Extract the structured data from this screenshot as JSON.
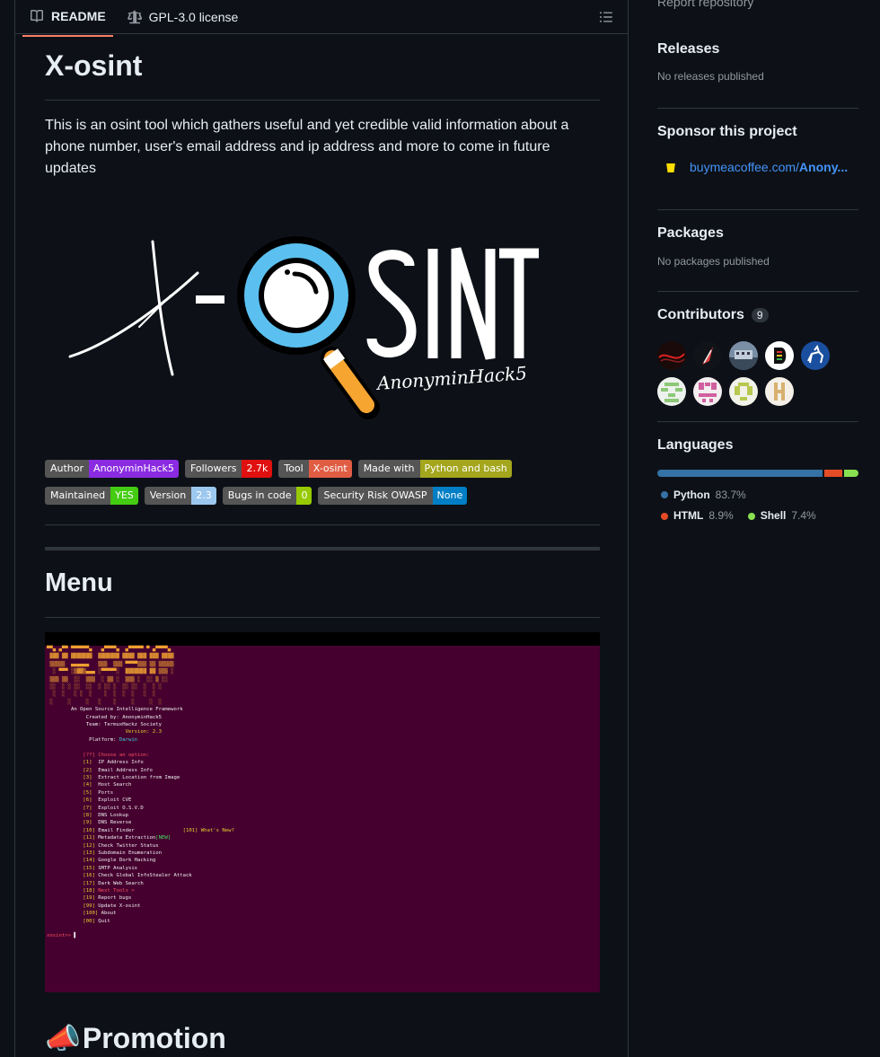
{
  "tabs": {
    "readme": "README",
    "license": "GPL-3.0 license"
  },
  "readme": {
    "title": "X-osint",
    "description": "This is an osint tool which gathers useful and yet credible valid information about a phone number, user's email address and ip address and more to come in future updates",
    "logo": {
      "word_left": "X-",
      "word_right": "SINT",
      "signature": "AnonyminHack5"
    },
    "badges_row1": [
      {
        "key": "Author",
        "value": "AnonyminHack5",
        "color": "#8a2be2"
      },
      {
        "key": "Followers",
        "value": "2.7k",
        "color": "#e01010"
      },
      {
        "key": "Tool",
        "value": "X-osint",
        "color": "#e05d44"
      },
      {
        "key": "Made with",
        "value": "Python and bash",
        "color": "#a4a61d"
      }
    ],
    "badges_row2": [
      {
        "key": "Maintained",
        "value": "YES",
        "color": "#4c1"
      },
      {
        "key": "Version",
        "value": "2.3",
        "color": "#9cc8ef"
      },
      {
        "key": "Bugs in code",
        "value": "0",
        "color": "#97ca00"
      },
      {
        "key": "Security Risk OWASP",
        "value": "None",
        "color": "#007ec6"
      }
    ],
    "menu_heading": "Menu",
    "terminal": {
      "tagline": "An Open Source Intelligence Framework",
      "created_by": "Created by: AnonyminHack5",
      "team": "Team: TermuxHackz Society",
      "version": "Version: 2.3",
      "platform_label": "Platform:",
      "platform_value": "Darwin",
      "prompt_choose": "[??] Choose an option:",
      "options": [
        "[1]  IP Address Info",
        "[2]  Email Address Info",
        "[3]  Extract Location from Image",
        "[4]  Host Search",
        "[5]  Ports",
        "[6]  Exploit CVE",
        "[7]  Exploit O.S.V.D",
        "[8]  DNS Lookup",
        "[9]  DNS Reverse",
        "[10] Email Finder",
        "[11] Metadata Extraction",
        "[12] Check Twitter Status",
        "[13] Subdomain Enumeration",
        "[14] Google Dork Hacking",
        "[15] SMTP Analysis",
        "[16] Check Global InfoStealer Attack",
        "[17] Dark Web Search",
        "[18] Next Tools >",
        "[19] Report bugs",
        "[99] Update X-osint",
        "[100] About",
        "[00] Quit"
      ],
      "whats_new": "[101] What's New?",
      "new_tag": "[NEW]",
      "prompt": "xosint>>"
    },
    "promotion_heading": "Promotion",
    "promotion_icon": "📣"
  },
  "sidebar": {
    "report": "Report repository",
    "releases": {
      "title": "Releases",
      "note": "No releases published"
    },
    "sponsor": {
      "title": "Sponsor this project",
      "link_prefix": "buymeacoffee.com/",
      "link_bold": "Anony..."
    },
    "packages": {
      "title": "Packages",
      "note": "No packages published"
    },
    "contributors": {
      "title": "Contributors",
      "count": "9"
    },
    "languages": {
      "title": "Languages",
      "items": [
        {
          "name": "Python",
          "pct": "83.7%",
          "value": 83.7,
          "color": "#3572A5"
        },
        {
          "name": "HTML",
          "pct": "8.9%",
          "value": 8.9,
          "color": "#e34c26"
        },
        {
          "name": "Shell",
          "pct": "7.4%",
          "value": 7.4,
          "color": "#89e051"
        }
      ]
    }
  }
}
